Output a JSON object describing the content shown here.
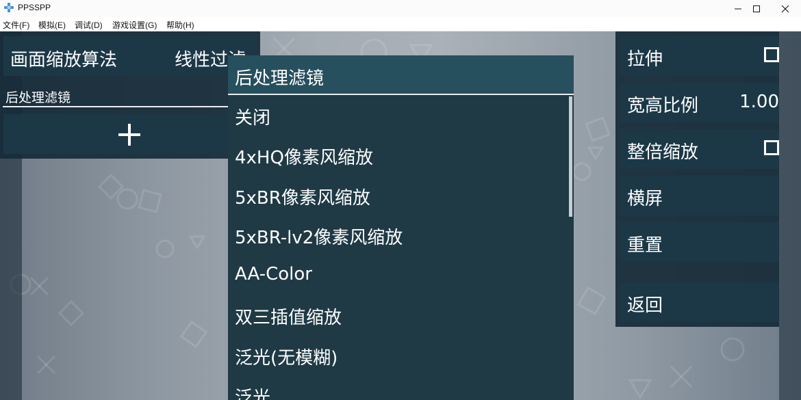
{
  "window": {
    "title": "PPSSPP"
  },
  "menu": [
    {
      "label": "文件(F)"
    },
    {
      "label": "模拟(E)"
    },
    {
      "label": "调试(D)"
    },
    {
      "label": "游戏设置(G)"
    },
    {
      "label": "帮助(H)"
    }
  ],
  "left_panel": {
    "scaling_label": "画面缩放算法",
    "scaling_value": "线性过滤",
    "filter_label": "后处理滤镜",
    "add_icon": "plus-icon"
  },
  "right_panel": {
    "stretch_label": "拉伸",
    "stretch_checked": false,
    "aspect_label": "宽高比例",
    "aspect_value": "1.00",
    "integer_label": "整倍缩放",
    "integer_checked": false,
    "landscape_label": "横屏",
    "reset_label": "重置",
    "back_label": "返回"
  },
  "popup": {
    "title": "后处理滤镜",
    "items": [
      {
        "label": "关闭"
      },
      {
        "label": "4xHQ像素风缩放"
      },
      {
        "label": "5xBR像素风缩放"
      },
      {
        "label": "5xBR-lv2像素风缩放"
      },
      {
        "label": "AA-Color"
      },
      {
        "label": "双三插值缩放"
      },
      {
        "label": "泛光(无模糊)"
      },
      {
        "label": "泛光"
      }
    ]
  },
  "colors": {
    "panel": "#1c3847",
    "popup_bg": "#1f3a45",
    "popup_header": "#27505f"
  }
}
